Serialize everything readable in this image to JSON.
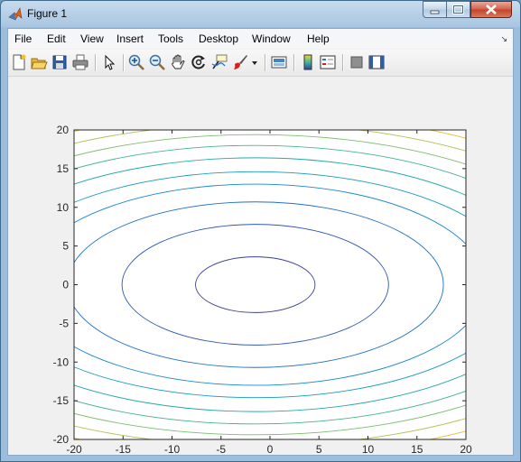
{
  "window": {
    "title": "Figure 1",
    "accent": "#d9641e"
  },
  "menu": {
    "items": [
      "File",
      "Edit",
      "View",
      "Insert",
      "Tools",
      "Desktop",
      "Window",
      "Help"
    ]
  },
  "toolbar": {
    "icons": [
      "new-figure-icon",
      "open-file-icon",
      "save-icon",
      "print-icon",
      "edit-plot-icon",
      "zoom-in-icon",
      "zoom-out-icon",
      "pan-icon",
      "rotate-3d-icon",
      "data-cursor-icon",
      "brush-icon",
      "brush-dropdown-icon",
      "link-plot-icon",
      "colorbar-icon",
      "legend-icon",
      "hide-plot-tools-icon",
      "show-plot-tools-icon"
    ]
  },
  "chart_data": {
    "type": "contour",
    "xlim": [
      -20,
      20
    ],
    "ylim": [
      -20,
      20
    ],
    "xticks": [
      "-20",
      "-15",
      "-10",
      "-5",
      "0",
      "5",
      "10",
      "15",
      "20"
    ],
    "yticks": [
      "20",
      "15",
      "10",
      "5",
      "0",
      "-5",
      "-10",
      "-15",
      "-20"
    ],
    "center": [
      -1.5,
      0
    ],
    "contours": [
      {
        "a": 6.1,
        "b": 3.6,
        "color": "#3a3f8f"
      },
      {
        "a": 13.6,
        "b": 7.8,
        "color": "#2e56b4"
      },
      {
        "a": 19.2,
        "b": 10.7,
        "color": "#1f6fc9"
      },
      {
        "a": 23.5,
        "b": 13.0,
        "color": "#1786cc"
      },
      {
        "a": 27.0,
        "b": 14.6,
        "color": "#1599bd"
      },
      {
        "a": 30.3,
        "b": 16.4,
        "color": "#25a7a8"
      },
      {
        "a": 33.3,
        "b": 18.0,
        "color": "#44b48f"
      },
      {
        "a": 36.0,
        "b": 19.4,
        "color": "#7dbc6f"
      },
      {
        "a": 38.6,
        "b": 20.8,
        "color": "#b5bd55"
      },
      {
        "a": 41.1,
        "b": 22.2,
        "color": "#e0ba37"
      },
      {
        "a": 43.4,
        "b": 23.5,
        "color": "#f4c81f"
      }
    ],
    "grid": false
  }
}
